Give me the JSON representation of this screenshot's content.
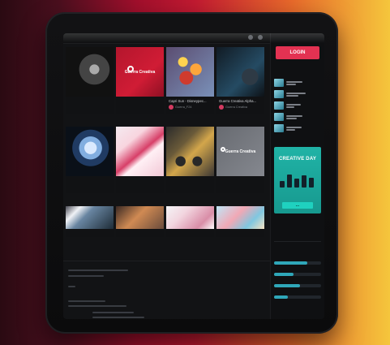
{
  "topbar": {
    "left_text": "",
    "right_text": ""
  },
  "sidebar": {
    "login_label": "LOGIN",
    "promo": {
      "title": "CREATIVE DAY",
      "button_label": "..."
    }
  },
  "cards": [
    {
      "title": "",
      "subtitle": "",
      "image": "img-blackcar"
    },
    {
      "title": "",
      "subtitle": "",
      "image": "img-pinklogo",
      "logo_text": "Guerra Creativa"
    },
    {
      "title": "Capri Sun - Disneypec...",
      "subtitle": "Guerra_F24",
      "image": "img-toys"
    },
    {
      "title": "Guerra Creativa Alpha...",
      "subtitle": "Guerra Creativa",
      "image": "img-car2"
    },
    {
      "title": "",
      "subtitle": "",
      "image": "img-blue3"
    },
    {
      "title": "",
      "subtitle": "",
      "image": "img-red-swoosh"
    },
    {
      "title": "",
      "subtitle": "",
      "image": "img-yellowcar"
    },
    {
      "title": "",
      "subtitle": "",
      "image": "img-gray-logo",
      "logo_text": "Guerra Creativa"
    },
    {
      "title": "",
      "subtitle": "",
      "image": "img-paper"
    },
    {
      "title": "",
      "subtitle": "",
      "image": "img-brown"
    },
    {
      "title": "",
      "subtitle": "",
      "image": "img-pinkscene"
    },
    {
      "title": "",
      "subtitle": "",
      "image": "img-pastel"
    }
  ]
}
